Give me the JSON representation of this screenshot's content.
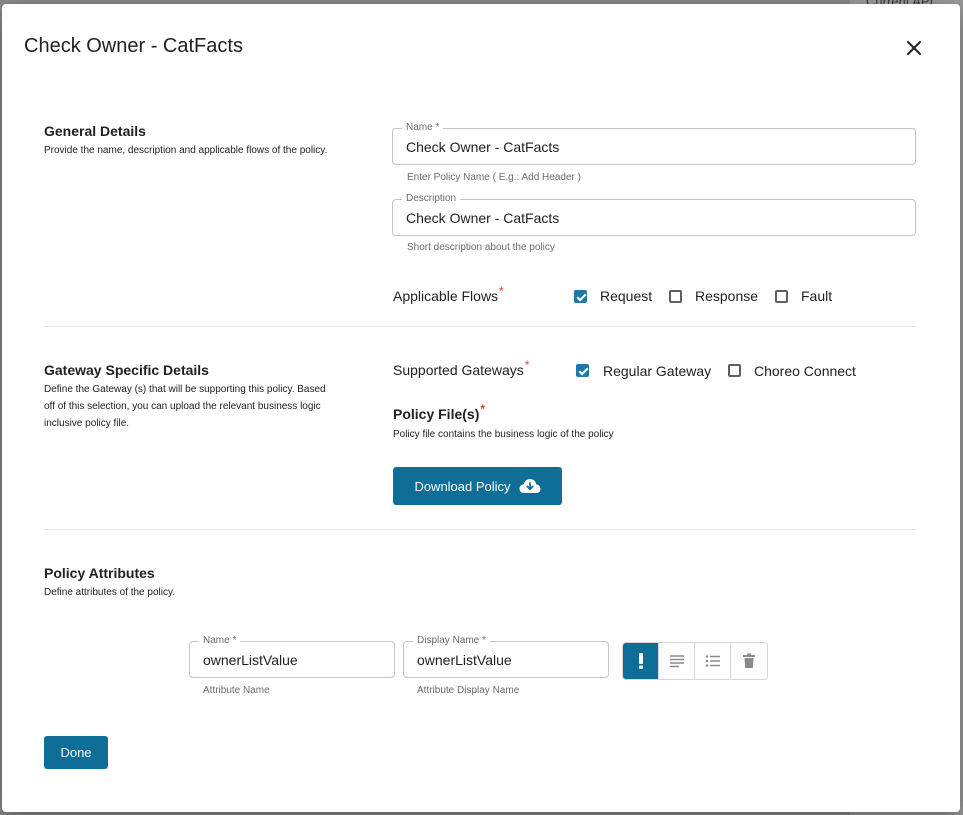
{
  "background": {
    "corner_text": "Current API"
  },
  "dialog": {
    "title": "Check Owner - CatFacts"
  },
  "general": {
    "title": "General Details",
    "desc": "Provide the name, description and applicable flows of the policy.",
    "name_label": "Name *",
    "name_value": "Check Owner - CatFacts",
    "name_helper": "Enter Policy Name ( E.g.: Add Header )",
    "desc_label": "Description",
    "desc_value": "Check Owner - CatFacts",
    "desc_helper": "Short description about the policy",
    "flows_label": "Applicable Flows",
    "flows": [
      {
        "label": "Request",
        "checked": true
      },
      {
        "label": "Response",
        "checked": false
      },
      {
        "label": "Fault",
        "checked": false
      }
    ]
  },
  "gateway": {
    "title": "Gateway Specific Details",
    "desc_lines": [
      "Define the Gateway (s) that will be supporting this policy. Based",
      "off of this selection, you can upload the relevant business logic",
      "inclusive policy file."
    ],
    "supported_label": "Supported Gateways",
    "gateways": [
      {
        "label": "Regular Gateway",
        "checked": true
      },
      {
        "label": "Choreo Connect",
        "checked": false
      }
    ],
    "policy_file_title": "Policy File(s)",
    "policy_file_desc": "Policy file contains the business logic of the policy",
    "download_label": "Download Policy"
  },
  "attributes": {
    "title": "Policy Attributes",
    "desc": "Define attributes of the policy.",
    "name_label": "Name *",
    "name_value": "ownerListValue",
    "name_helper": "Attribute Name",
    "display_label": "Display Name *",
    "display_value": "ownerListValue",
    "display_helper": "Attribute Display Name"
  },
  "footer": {
    "done_label": "Done"
  },
  "colors": {
    "accent": "#0f6e97",
    "required": "#e53935"
  }
}
